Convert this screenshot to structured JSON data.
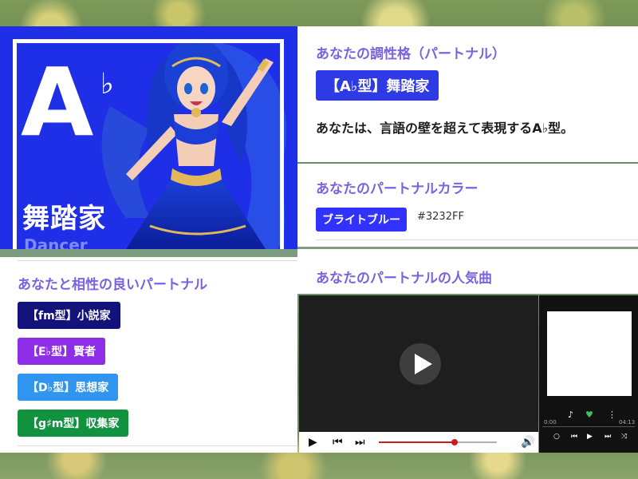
{
  "hero": {
    "key_letter": "A",
    "key_accidental": "♭",
    "type_name": "舞踏家",
    "type_name_en": "Dancer"
  },
  "personality": {
    "title": "あなたの調性格（パートナル）",
    "badge": "【A♭型】舞踏家",
    "description": "あなたは、言語の壁を超えて表現するA♭型。"
  },
  "color": {
    "title": "あなたのパートナルカラー",
    "name": "ブライトブルー",
    "hex": "#3232FF"
  },
  "song": {
    "title": "あなたのパートナルの人気曲"
  },
  "partners": {
    "title": "あなたと相性の良いパートナル",
    "items": [
      {
        "label": "【fm型】小説家",
        "color": "#12127a"
      },
      {
        "label": "【E♭型】賢者",
        "color": "#8f2ee8"
      },
      {
        "label": "【D♭型】思想家",
        "color": "#2f95f0"
      },
      {
        "label": "【g♯m型】収集家",
        "color": "#11923e"
      }
    ]
  },
  "player": {
    "progress": 0.64,
    "play_icon": "play-icon",
    "mini_time_start": "0:00",
    "mini_time_end": "04:13"
  },
  "accent": "#7b63e0",
  "brand_blue": "#1f2fe8"
}
